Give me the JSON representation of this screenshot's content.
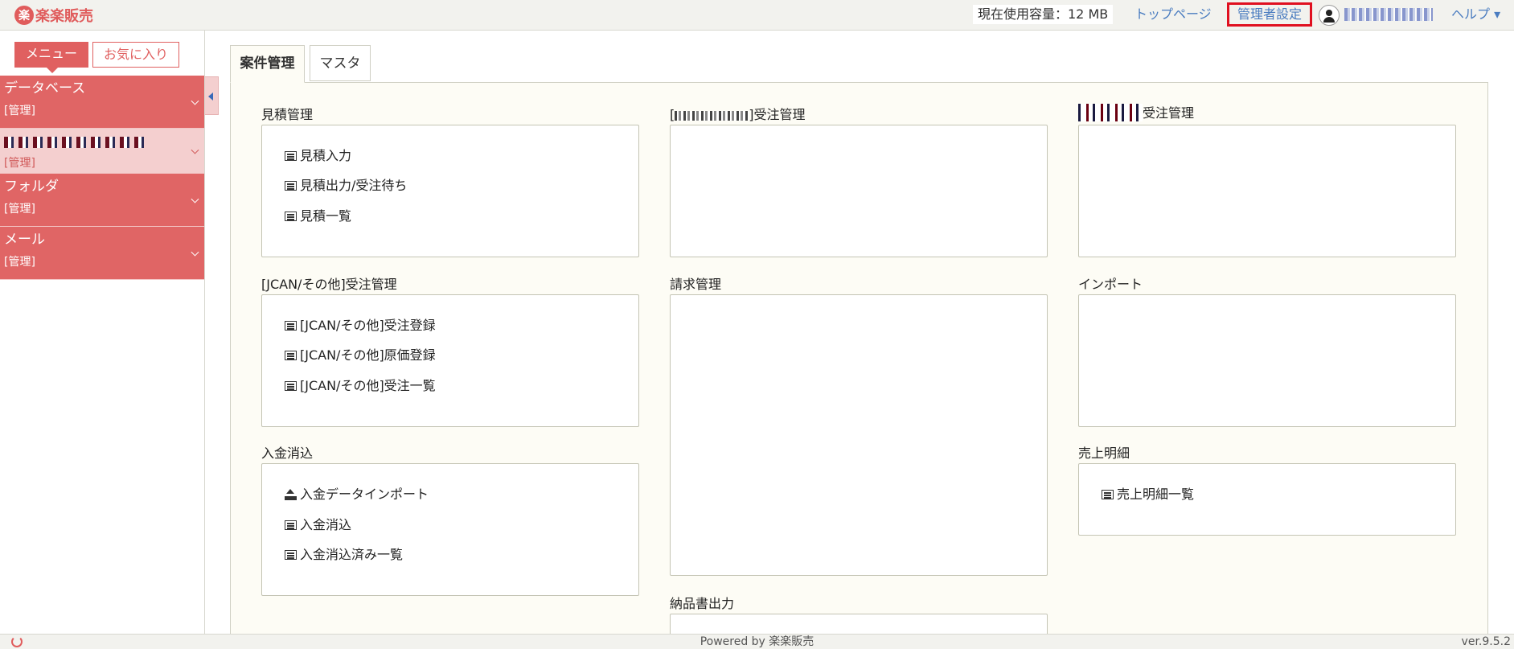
{
  "app": {
    "logo_text": "楽楽販売",
    "logo_mark": "楽"
  },
  "header": {
    "usage": "現在使用容量：12 MB",
    "top_page": "トップページ",
    "admin_settings": "管理者設定",
    "help": "ヘルプ ▾"
  },
  "sidebar": {
    "tabs": {
      "menu": "メニュー",
      "favorites": "お気に入り"
    },
    "items": [
      {
        "title": "データベース",
        "sub": "[管理]"
      },
      {
        "title": "",
        "sub": "[管理]"
      },
      {
        "title": "フォルダ",
        "sub": "[管理]"
      },
      {
        "title": "メール",
        "sub": "[管理]"
      }
    ]
  },
  "main": {
    "tabs": [
      "案件管理",
      "マスタ"
    ],
    "sections": {
      "estimate": {
        "title": "見積管理",
        "items": [
          "見積入力",
          "見積出力/受注待ち",
          "見積一覧"
        ]
      },
      "jcan": {
        "title": "[JCAN/その他]受注管理",
        "items": [
          "[JCAN/その他]受注登録",
          "[JCAN/その他]原価登録",
          "[JCAN/その他]受注一覧"
        ]
      },
      "payment": {
        "title": "入金消込",
        "items": [
          "入金データインポート",
          "入金消込",
          "入金消込済み一覧"
        ]
      },
      "bracket_order": {
        "prefix": "[",
        "suffix": "]受注管理"
      },
      "billing": {
        "title": "請求管理"
      },
      "delivery": {
        "title": "納品書出力"
      },
      "masked_order": {
        "suffix": "受注管理"
      },
      "import": {
        "title": "インポート"
      },
      "sales": {
        "title": "売上明細",
        "items": [
          "売上明細一覧"
        ]
      }
    }
  },
  "footer": {
    "powered": "Powered by 楽楽販売",
    "version": "ver.9.5.2"
  },
  "colors": {
    "accent": "#e06060",
    "link": "#4a7cc0",
    "highlight_border": "#e01020"
  }
}
